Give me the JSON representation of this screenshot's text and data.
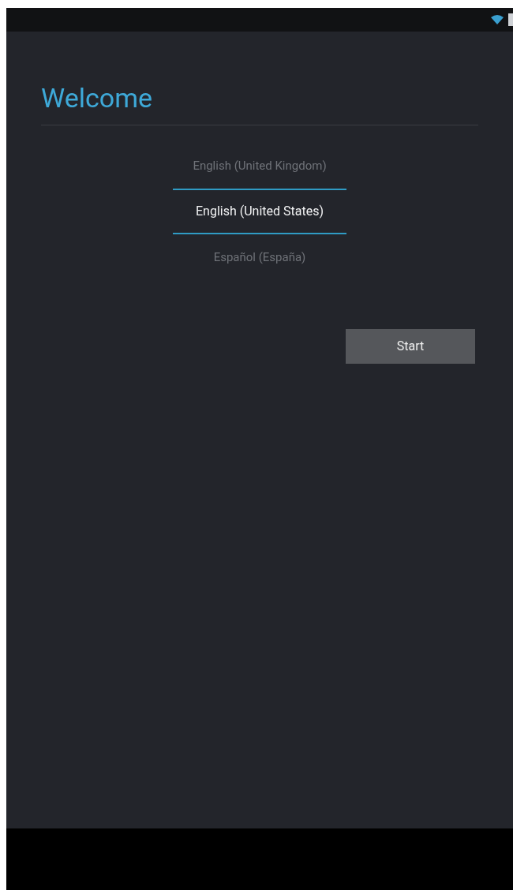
{
  "title": "Welcome",
  "languages": [
    {
      "label": "English (United Kingdom)",
      "selected": false
    },
    {
      "label": "English (United States)",
      "selected": true
    },
    {
      "label": "Español (España)",
      "selected": false
    }
  ],
  "button": "Start"
}
